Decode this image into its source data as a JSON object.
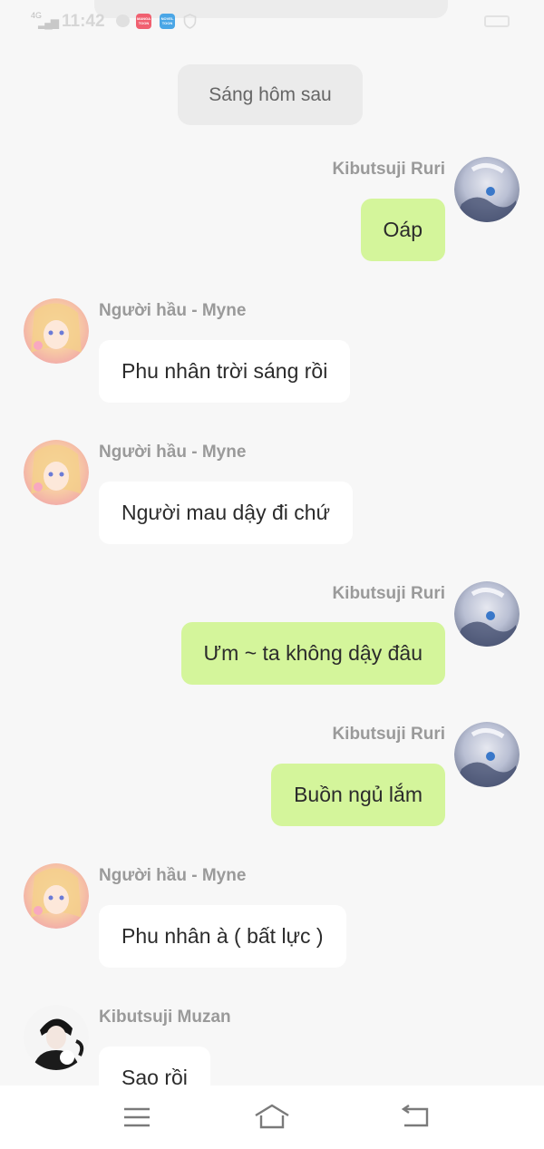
{
  "status_bar": {
    "network": "4G",
    "time": "11:42",
    "app_icon_1": "MANGA TOON",
    "app_icon_2": "NOVEL TOON",
    "icons": [
      "signal-icon",
      "chat-bubble-icon",
      "mangatoon-app-icon",
      "noveltoon-app-icon",
      "shield-icon",
      "battery-icon"
    ]
  },
  "chat": {
    "date_divider": "Sáng hôm sau",
    "messages": [
      {
        "sender": "Kibutsuji Ruri",
        "text": "Oáp",
        "side": "right"
      },
      {
        "sender": "Người hầu - Myne",
        "text": "Phu nhân trời sáng rồi",
        "side": "left"
      },
      {
        "sender": "Người hầu - Myne",
        "text": "Người mau dậy đi chứ",
        "side": "left"
      },
      {
        "sender": "Kibutsuji Ruri",
        "text": "Ưm ~ ta không dậy đâu",
        "side": "right"
      },
      {
        "sender": "Kibutsuji Ruri",
        "text": "Buồn ngủ lắm",
        "side": "right"
      },
      {
        "sender": "Người hầu - Myne",
        "text": "Phu nhân à ( bất lực )",
        "side": "left"
      },
      {
        "sender": "Kibutsuji Muzan",
        "text": "Sao rồi",
        "side": "left"
      }
    ]
  },
  "nav_bar": {
    "icons": [
      "menu-icon",
      "home-icon",
      "back-icon"
    ]
  },
  "colors": {
    "background": "#f7f7f7",
    "my_bubble": "#d4f59b",
    "other_bubble": "#ffffff",
    "sender_name": "#9a9a9a",
    "date_pill": "#ebebeb"
  }
}
